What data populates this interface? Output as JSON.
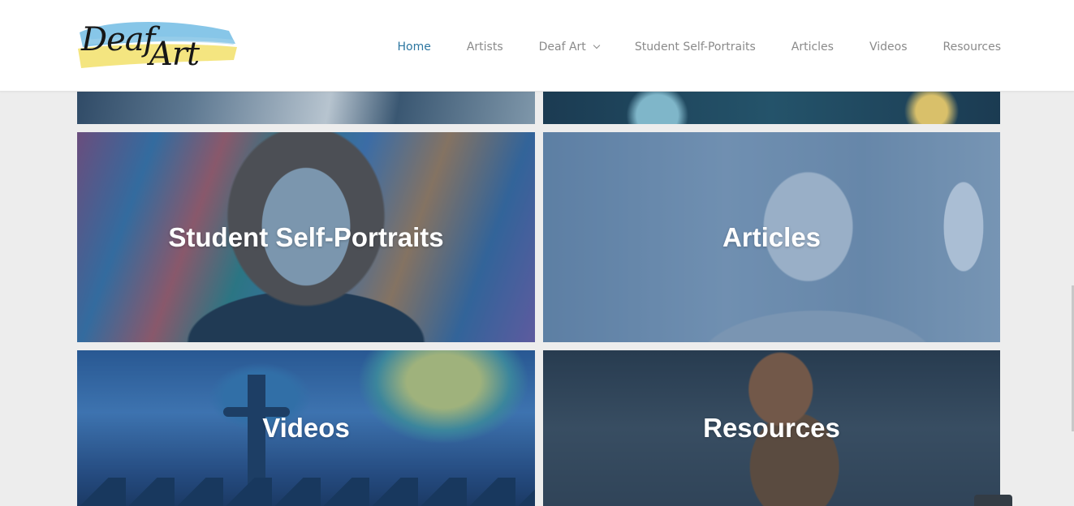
{
  "brand": {
    "logo_line1": "Deaf",
    "logo_line2": "Art",
    "accent": "#2c76a0"
  },
  "nav": {
    "items": [
      {
        "label": "Home",
        "active": true
      },
      {
        "label": "Artists"
      },
      {
        "label": "Deaf Art",
        "has_dropdown": true
      },
      {
        "label": "Student Self-Portraits"
      },
      {
        "label": "Articles"
      },
      {
        "label": "Videos"
      },
      {
        "label": "Resources"
      }
    ]
  },
  "tiles": {
    "student_self_portraits": "Student Self-Portraits",
    "articles": "Articles",
    "videos": "Videos",
    "resources": "Resources"
  }
}
